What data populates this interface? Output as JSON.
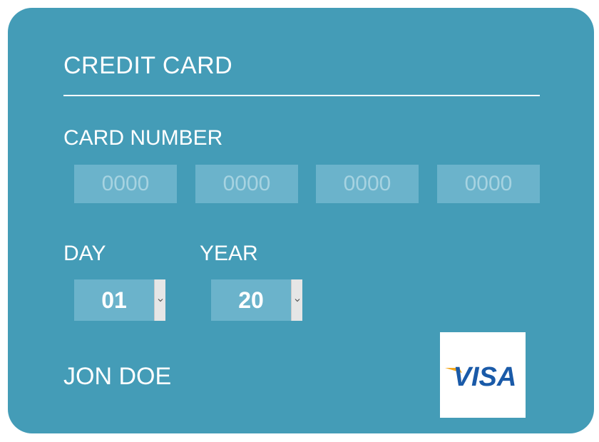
{
  "card": {
    "title": "CREDIT CARD",
    "card_number_label": "CARD NUMBER",
    "card_number_fields": [
      {
        "placeholder": "0000",
        "value": ""
      },
      {
        "placeholder": "0000",
        "value": ""
      },
      {
        "placeholder": "0000",
        "value": ""
      },
      {
        "placeholder": "0000",
        "value": ""
      }
    ],
    "day": {
      "label": "DAY",
      "selected": "01"
    },
    "year": {
      "label": "YEAR",
      "selected": "20"
    },
    "cardholder_name": "JON DOE",
    "logo": {
      "text": "VISA",
      "icon": "visa-logo-icon"
    }
  },
  "colors": {
    "card_background": "#449cb7",
    "input_background": "#6bb3cb",
    "placeholder_text": "#a6d3e1",
    "text": "#ffffff",
    "visa_blue": "#1a5aa8",
    "visa_gold": "#f3a820"
  }
}
